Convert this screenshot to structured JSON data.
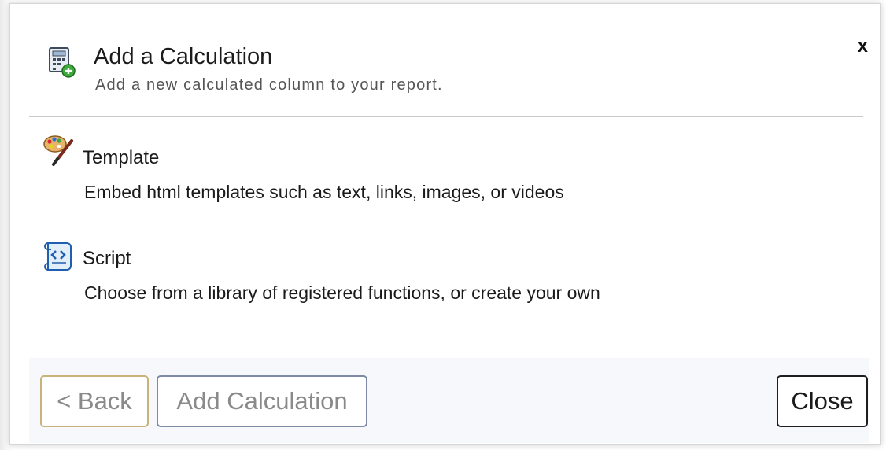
{
  "dialog": {
    "title": "Add a Calculation",
    "subtitle": "Add a new calculated column to your report.",
    "close_glyph": "x"
  },
  "options": [
    {
      "label": "Template",
      "description": "Embed html templates such as text, links, images, or videos",
      "icon": "palette-brush-icon"
    },
    {
      "label": "Script",
      "description": "Choose from a library of registered functions, or create your own",
      "icon": "script-scroll-icon"
    }
  ],
  "footer": {
    "back_label": "< Back",
    "add_label": "Add Calculation",
    "close_label": "Close"
  },
  "colors": {
    "back_border": "#c9b37a",
    "add_border": "#7e8aa6",
    "disabled_text": "#8a8a8a"
  }
}
